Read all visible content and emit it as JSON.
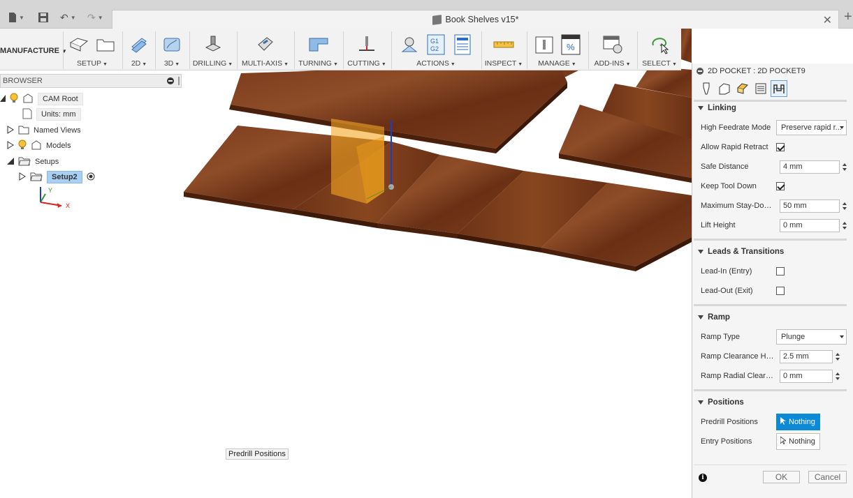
{
  "window": {
    "doc_title": "Book Shelves v15*"
  },
  "toolbar": {
    "workspace": "MANUFACTURE",
    "groups": [
      {
        "label": "SETUP"
      },
      {
        "label": "2D"
      },
      {
        "label": "3D"
      },
      {
        "label": "DRILLING"
      },
      {
        "label": "MULTI-AXIS"
      },
      {
        "label": "TURNING"
      },
      {
        "label": "CUTTING"
      },
      {
        "label": "ACTIONS"
      },
      {
        "label": "INSPECT"
      },
      {
        "label": "MANAGE"
      },
      {
        "label": "ADD-INS"
      },
      {
        "label": "SELECT"
      }
    ],
    "gcode_icon_text": "G1\nG2",
    "percent_icon_text": "%"
  },
  "browser": {
    "title": "BROWSER",
    "items": [
      {
        "label": "CAM Root"
      },
      {
        "label": "Units: mm"
      },
      {
        "label": "Named Views"
      },
      {
        "label": "Models"
      },
      {
        "label": "Setups"
      },
      {
        "label": "Setup2"
      }
    ],
    "axis_y": "Y",
    "axis_x": "X"
  },
  "viewport": {
    "tooltip": "Predrill Positions"
  },
  "dialog": {
    "title": "2D POCKET : 2D POCKET9",
    "sections": {
      "linking": {
        "title": "Linking",
        "high_feedrate_mode": {
          "label": "High Feedrate Mode",
          "value": "Preserve rapid r..."
        },
        "allow_rapid_retract": {
          "label": "Allow Rapid Retract",
          "checked": true
        },
        "safe_distance": {
          "label": "Safe Distance",
          "value": "4 mm"
        },
        "keep_tool_down": {
          "label": "Keep Tool Down",
          "checked": true
        },
        "max_stay_down": {
          "label": "Maximum Stay-Dowr...",
          "value": "50 mm"
        },
        "lift_height": {
          "label": "Lift Height",
          "value": "0 mm"
        }
      },
      "leads": {
        "title": "Leads & Transitions",
        "lead_in": {
          "label": "Lead-In (Entry)",
          "checked": false
        },
        "lead_out": {
          "label": "Lead-Out (Exit)",
          "checked": false
        }
      },
      "ramp": {
        "title": "Ramp",
        "ramp_type": {
          "label": "Ramp Type",
          "value": "Plunge"
        },
        "ramp_clearance": {
          "label": "Ramp Clearance Hei...",
          "value": "2.5 mm"
        },
        "ramp_radial": {
          "label": "Ramp Radial Clearan...",
          "value": "0 mm"
        }
      },
      "positions": {
        "title": "Positions",
        "predrill": {
          "label": "Predrill Positions",
          "value": "Nothing"
        },
        "entry": {
          "label": "Entry Positions",
          "value": "Nothing"
        }
      }
    },
    "ok_label": "OK",
    "cancel_label": "Cancel"
  },
  "colors": {
    "wood": "#6e3418",
    "wood_light": "#8a4a26",
    "accent_blue": "#0c8ad6",
    "tool_orange": "#f0a020"
  }
}
